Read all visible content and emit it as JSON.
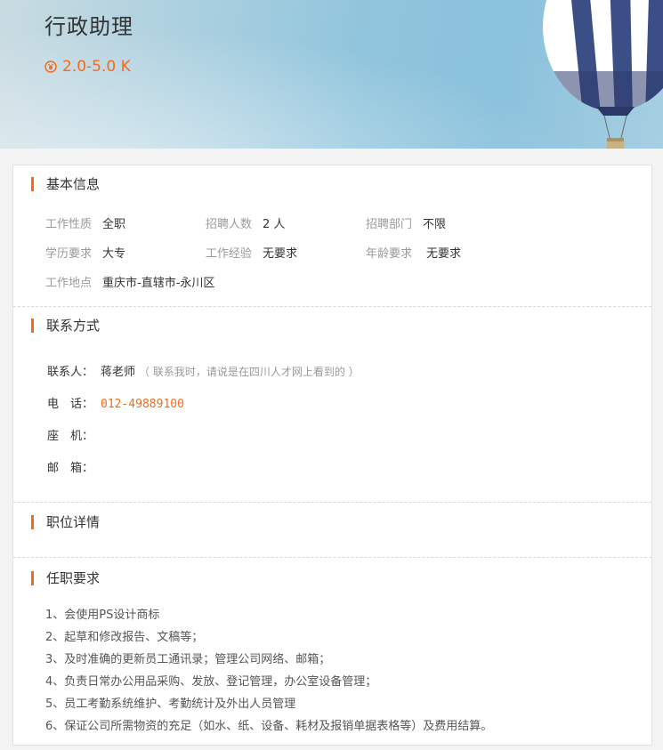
{
  "header": {
    "title": "行政助理",
    "salary": "2.0-5.0 K"
  },
  "basic": {
    "title": "基本信息",
    "rows": [
      [
        {
          "k": "工作性质",
          "v": "全职"
        },
        {
          "k": "招聘人数",
          "v": "2 人"
        },
        {
          "k": "招聘部门",
          "v": "不限"
        }
      ],
      [
        {
          "k": "学历要求",
          "v": "大专"
        },
        {
          "k": "工作经验",
          "v": "无要求"
        },
        {
          "k": "年龄要求",
          "v": "无要求"
        }
      ],
      [
        {
          "k": "工作地点",
          "v": "重庆市-直辖市-永川区"
        }
      ]
    ]
  },
  "contact": {
    "title": "联系方式",
    "person_label": "联系人：",
    "person": "蒋老师",
    "note": "（ 联系我时，请说是在四川人才网上看到的 ）",
    "phone_label": "电　话：",
    "phone": "012-49889100",
    "landline_label": "座　机：",
    "email_label": "邮　箱："
  },
  "detail": {
    "title": "职位详情"
  },
  "requirements": {
    "title": "任职要求",
    "items": [
      "1、会使用PS设计商标",
      "2、起草和修改报告、文稿等；",
      "3、及时准确的更新员工通讯录；管理公司网络、邮箱；",
      "4、负责日常办公用品采购、发放、登记管理，办公室设备管理；",
      "5、员工考勤系统维护、考勤统计及外出人员管理",
      "6、保证公司所需物资的充足（如水、纸、设备、耗材及报销单据表格等）及费用结算。"
    ]
  },
  "colors": {
    "accent": "#f26b1d"
  }
}
